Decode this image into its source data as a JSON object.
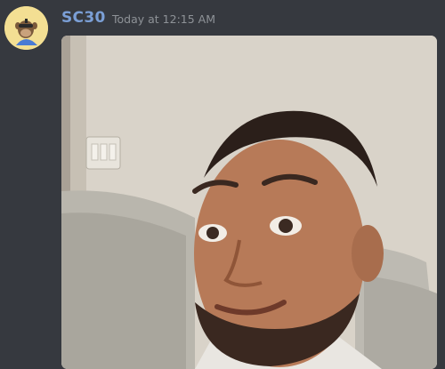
{
  "message": {
    "author": "SC30",
    "timestamp": "Today at 12:15 AM",
    "avatar_icon": "cartoon-ape-avatar-icon",
    "attachment": {
      "kind": "selfie-photo",
      "palette": {
        "wall": "#d9d3c9",
        "sofa": "#b9b6ad",
        "skin": "#b77a58",
        "hair": "#2b1f1a"
      }
    }
  }
}
